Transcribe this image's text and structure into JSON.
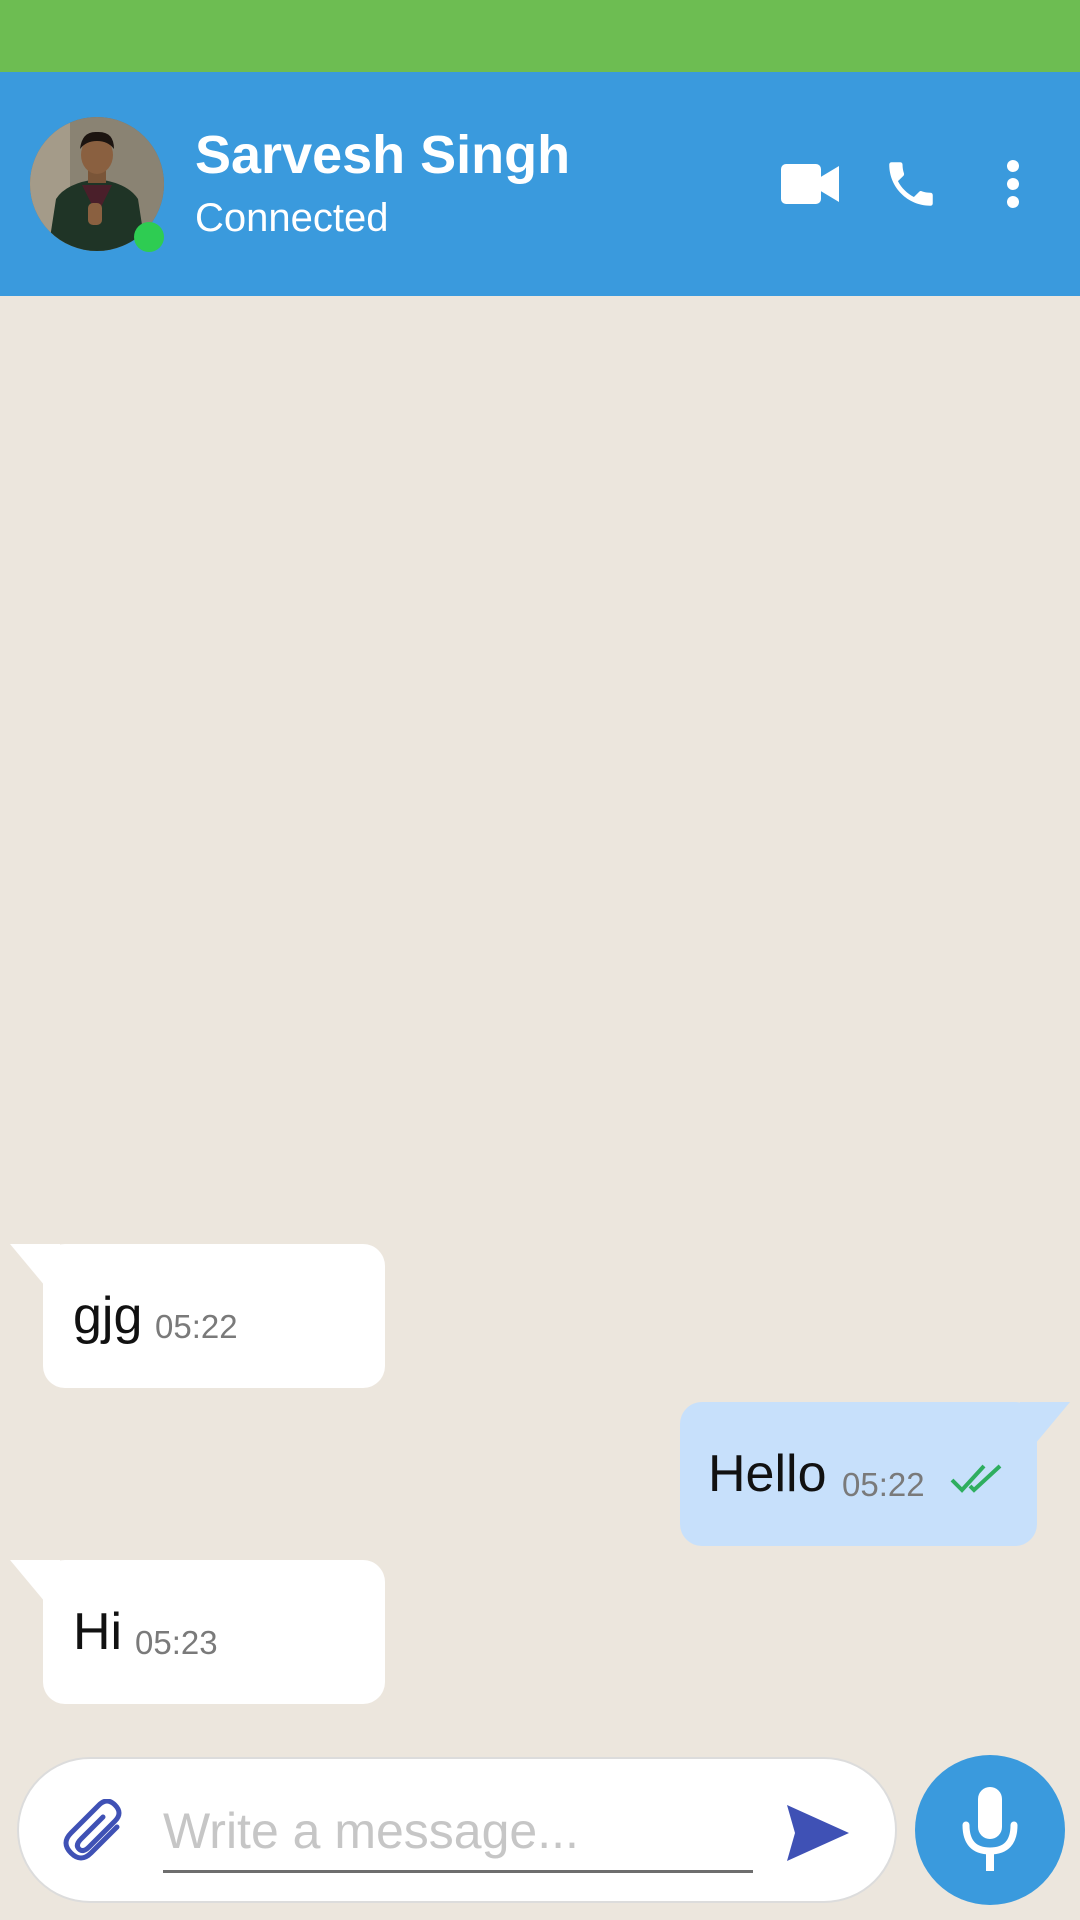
{
  "header": {
    "contact_name": "Sarvesh Singh",
    "contact_status": "Connected",
    "avatar": "profile-photo",
    "online_indicator_color": "#2ecc52",
    "actions": [
      "video-call-icon",
      "phone-call-icon",
      "more-vert-icon"
    ]
  },
  "messages": [
    {
      "direction": "incoming",
      "text": "gjg",
      "time": "05:22"
    },
    {
      "direction": "outgoing",
      "text": "Hello",
      "time": "05:22",
      "status": "read-double-check-icon"
    },
    {
      "direction": "incoming",
      "text": "Hi",
      "time": "05:23"
    }
  ],
  "composer": {
    "placeholder": "Write a message...",
    "value": "",
    "attach_icon": "paperclip-icon",
    "send_icon": "send-icon",
    "mic_icon": "microphone-icon"
  },
  "colors": {
    "status_bar": "#6dbd52",
    "app_bar": "#3a9add",
    "chat_background": "#ece6dd",
    "incoming_bubble": "#ffffff",
    "outgoing_bubble": "#c7e0fb",
    "read_ticks": "#2eae5f",
    "icon_accent": "#3f51b5"
  }
}
